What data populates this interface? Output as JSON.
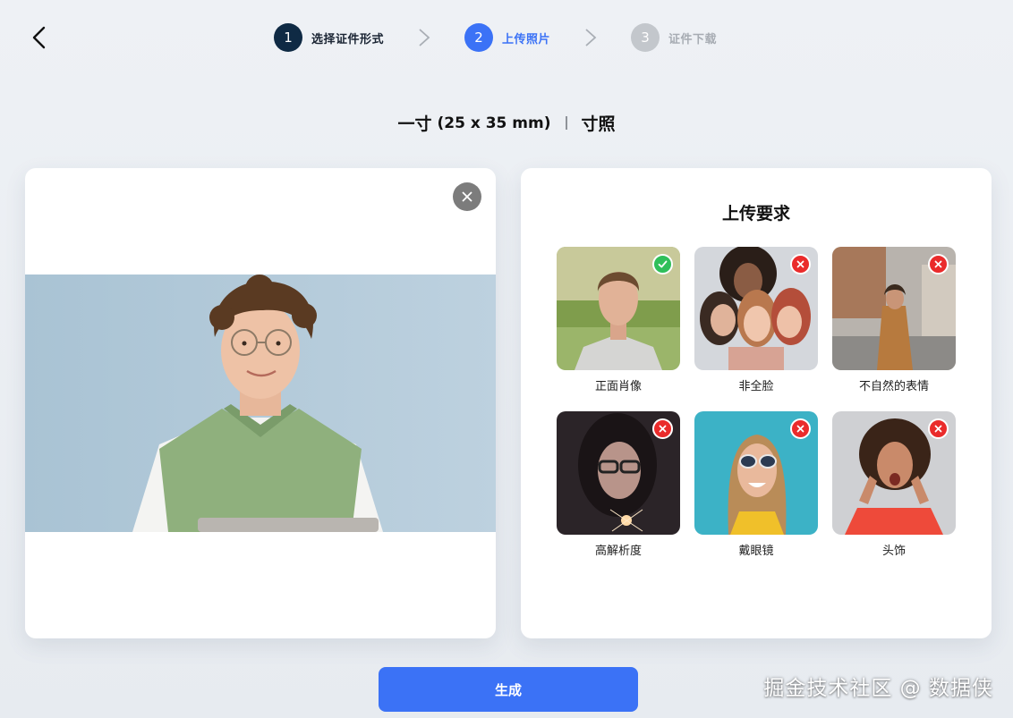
{
  "nav": {
    "back_icon": "chevron-left-icon"
  },
  "steps": [
    {
      "num": "1",
      "label": "选择证件形式",
      "state": "done"
    },
    {
      "num": "2",
      "label": "上传照片",
      "state": "active"
    },
    {
      "num": "3",
      "label": "证件下载",
      "state": "todo"
    }
  ],
  "size": {
    "name": "一寸",
    "dims": "(25 x 35 mm)",
    "type": "寸照"
  },
  "upload": {
    "remove_icon": "close-icon"
  },
  "requirements": {
    "title": "上传要求",
    "items": [
      {
        "label": "正面肖像",
        "status": "ok"
      },
      {
        "label": "非全脸",
        "status": "bad"
      },
      {
        "label": "不自然的表情",
        "status": "bad"
      },
      {
        "label": "高解析度",
        "status": "bad"
      },
      {
        "label": "戴眼镜",
        "status": "bad"
      },
      {
        "label": "头饰",
        "status": "bad"
      }
    ]
  },
  "actions": {
    "generate": "生成"
  },
  "watermark": "掘金技术社区 @ 数据侠",
  "colors": {
    "accent": "#3b72f6",
    "done": "#0f2a44",
    "ok": "#2fbf5a",
    "bad": "#ea2b2b"
  }
}
